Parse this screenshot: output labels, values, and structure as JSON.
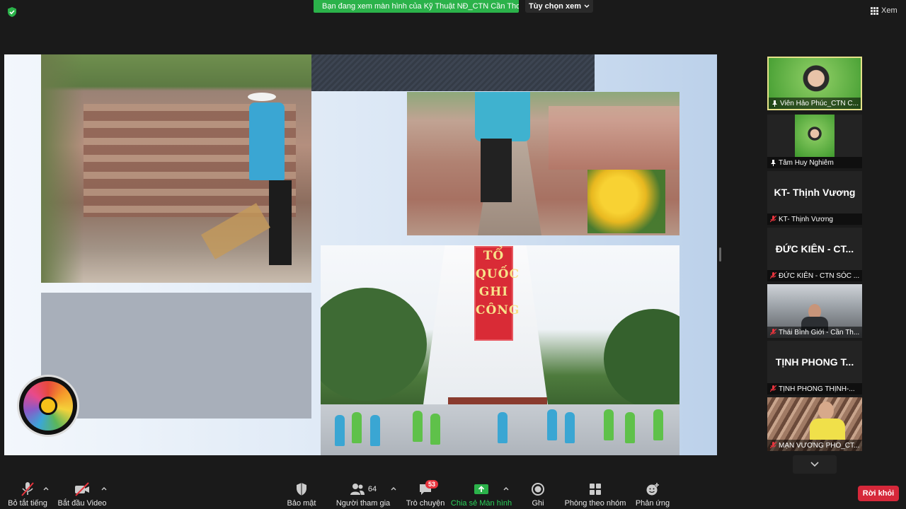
{
  "topbar": {
    "banner_text": "Bạn đang xem màn hình của Kỹ Thuật NĐ_CTN Cần Thơ",
    "view_options_label": "Tùy chọn xem",
    "view_label": "Xem"
  },
  "slide": {
    "monument_lines": [
      "TỔ",
      "QUỐC",
      "GHI",
      "CÔNG"
    ]
  },
  "participants": [
    {
      "name": "Viên Hảo Phúc_CTN C...",
      "status": "pinned",
      "video": true
    },
    {
      "name": "Tâm Huy Nghiêm",
      "status": "pinned",
      "video": true
    },
    {
      "name": "KT- Thịnh Vương",
      "display": "KT- Thịnh Vương",
      "status": "muted",
      "video": false
    },
    {
      "name": "ĐỨC KIÊN - CTN SÓC ...",
      "display": "ĐỨC KIÊN - CT...",
      "status": "muted",
      "video": false
    },
    {
      "name": "Thái Bình Giới - Cần Th...",
      "status": "muted",
      "video": true
    },
    {
      "name": "TỊNH PHONG THỊNH-...",
      "display": "TỊNH PHONG T...",
      "status": "muted",
      "video": false
    },
    {
      "name": "MẠN VƯƠNG PHO_CT...",
      "status": "muted",
      "video": true
    }
  ],
  "toolbar": {
    "mute_label": "Bỏ tắt tiếng",
    "video_label": "Bắt đầu Video",
    "security_label": "Bảo mật",
    "participants_label": "Người tham gia",
    "participants_count": "64",
    "chat_label": "Trò chuyện",
    "chat_badge": "53",
    "share_label": "Chia sẻ Màn hình",
    "record_label": "Ghi",
    "rooms_label": "Phòng theo nhóm",
    "reactions_label": "Phản ứng",
    "leave_label": "Rời khỏi"
  },
  "colors": {
    "share_green": "#2bb24a",
    "leave_red": "#d6283a",
    "badge_red": "#e8343d",
    "active_speaker_border": "#e6e28a"
  }
}
